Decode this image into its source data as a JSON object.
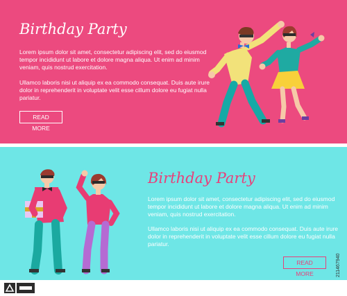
{
  "top_banner": {
    "title": "Birthday Party",
    "paragraph_1": "Lorem ipsum dolor sit amet, consectetur adipiscing elit, sed do eiusmod tempor incididunt ut labore et dolore magna aliqua. Ut enim ad minim veniam, quis nostrud exercitation.",
    "paragraph_2": "Ullamco laboris nisi ut aliquip ex ea commodo consequat. Duis aute irure dolor in reprehenderit in voluptate velit esse cillum dolore eu fugiat nulla pariatur.",
    "button_label": "READ MORE"
  },
  "bottom_banner": {
    "title": "Birthday Party",
    "paragraph_1": "Lorem ipsum dolor sit amet, consectetur adipiscing elit, sed do eiusmod tempor incididunt ut labore et dolore magna aliqua. Ut enim ad minim veniam, quis nostrud exercitation.",
    "paragraph_2": "Ullamco laboris nisi ut aliquip ex ea commodo consequat. Duis aute irure dolor in reprehenderit in voluptate velit esse cillum dolore eu fugiat nulla pariatur.",
    "button_label": "READ MORE"
  },
  "stock_id": "211467940",
  "colors": {
    "pink": "#ec4a7f",
    "cyan": "#6ee6e6",
    "accent_pink_text": "#e8407a"
  },
  "icons": [
    "dancing-man-figure",
    "dancing-woman-figure",
    "man-holding-gift-figure",
    "woman-waving-figure",
    "adobe-stock-logo"
  ]
}
